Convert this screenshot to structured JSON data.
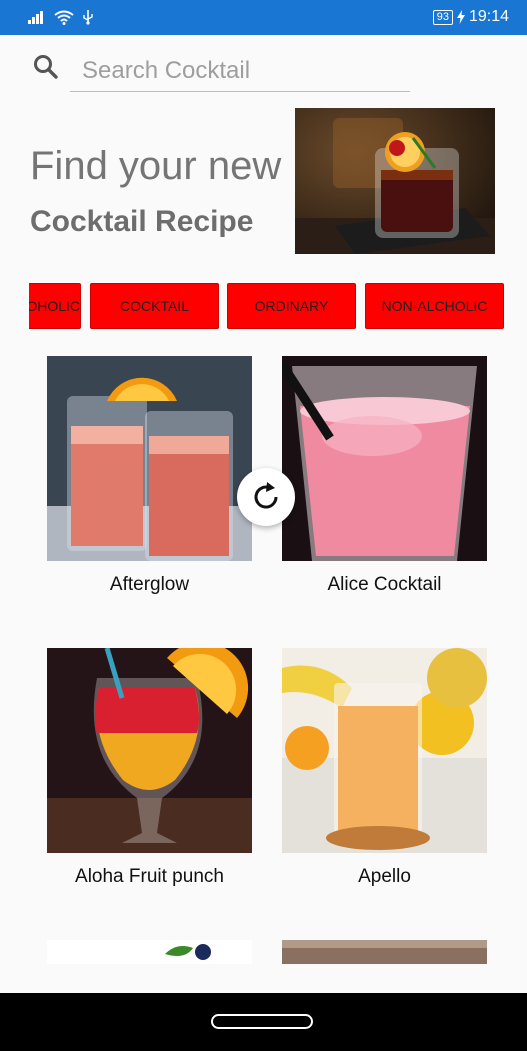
{
  "status_bar": {
    "battery": "93",
    "time": "19:14"
  },
  "search": {
    "placeholder": "Search Cocktail",
    "value": ""
  },
  "hero": {
    "title": "Find your new",
    "subtitle": "Cocktail Recipe"
  },
  "categories": [
    "ALCOHOLIC",
    "COCKTAIL",
    "ORDINARY",
    "NON-ALCHOLIC"
  ],
  "drinks": [
    {
      "name": "Afterglow"
    },
    {
      "name": "Alice Cocktail"
    },
    {
      "name": "Aloha Fruit punch"
    },
    {
      "name": "Apello"
    }
  ],
  "icons": {
    "search": "search-icon",
    "refresh": "refresh-icon",
    "home": "home-pill"
  },
  "colors": {
    "status_bar": "#1976d2",
    "chip": "#ff0000",
    "background": "#fafafa"
  }
}
